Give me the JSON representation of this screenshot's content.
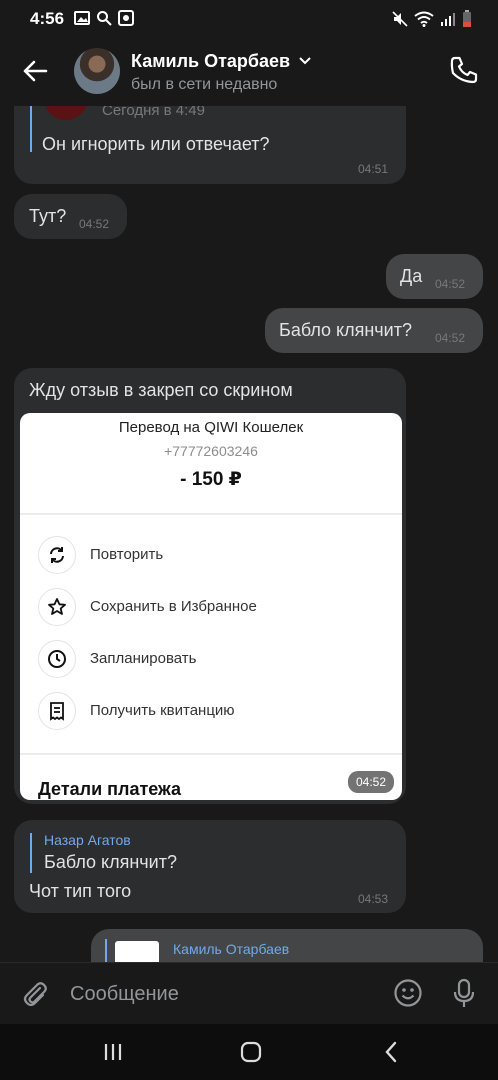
{
  "status_bar": {
    "time": "4:56"
  },
  "header": {
    "contact_name": "Камиль Отарбаев",
    "contact_status": "был в сети недавно"
  },
  "messages": {
    "m1": {
      "reply_time": "Сегодня в 4:49",
      "text": "Он игнорить или отвечает?",
      "time": "04:51"
    },
    "m2": {
      "text": "Тут?",
      "time": "04:52"
    },
    "m3": {
      "text": "Да",
      "time": "04:52"
    },
    "m4": {
      "text": "Бабло клянчит?",
      "time": "04:52"
    },
    "m5": {
      "text": "Жду отзыв в закреп со скрином",
      "time": "04:52",
      "screenshot": {
        "title": "Перевод на QIWI Кошелек",
        "phone": "+77772603246",
        "amount": "- 150 ₽",
        "actions": [
          {
            "label": "Повторить",
            "icon": "repeat-icon"
          },
          {
            "label": "Сохранить в Избранное",
            "icon": "star-icon"
          },
          {
            "label": "Запланировать",
            "icon": "clock-icon"
          },
          {
            "label": "Получить квитанцию",
            "icon": "receipt-icon"
          }
        ],
        "details": "Детали платежа"
      }
    },
    "m6": {
      "reply_author": "Назар Агатов",
      "reply_text": "Бабло клянчит?",
      "text": "Чот тип того",
      "time": "04:53"
    },
    "m7": {
      "reply_author": "Камиль Отарбаев"
    }
  },
  "composer": {
    "placeholder": "Сообщение"
  },
  "colors": {
    "background": "#19191a",
    "bubble_in": "#2c2d2e",
    "bubble_out": "#444547",
    "accent": "#71aaeb"
  }
}
